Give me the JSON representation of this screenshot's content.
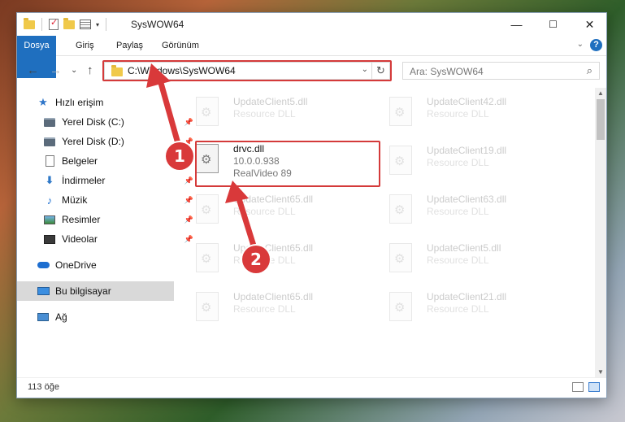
{
  "window": {
    "title": "SysWOW64",
    "minimize": "—",
    "maximize": "☐",
    "close": "✕"
  },
  "ribbon": {
    "tabs": [
      "Dosya",
      "Giriş",
      "Paylaş",
      "Görünüm"
    ],
    "expand": "⌄",
    "help": "?"
  },
  "nav": {
    "back": "←",
    "forward": "→",
    "recent": "⌄",
    "up": "↑",
    "address": "C:\\Windows\\SysWOW64",
    "address_dropdown": "⌄",
    "refresh": "↻",
    "search_placeholder": "Ara: SysWOW64",
    "search_icon": "⌕"
  },
  "sidebar": {
    "items": [
      {
        "label": "Hızlı erişim",
        "icon": "star-icon",
        "pinned": false
      },
      {
        "label": "Yerel Disk (C:)",
        "icon": "drive-icon",
        "pinned": true
      },
      {
        "label": "Yerel Disk (D:)",
        "icon": "drive-icon",
        "pinned": true
      },
      {
        "label": "Belgeler",
        "icon": "document-icon",
        "pinned": true
      },
      {
        "label": "İndirmeler",
        "icon": "download-icon",
        "pinned": true
      },
      {
        "label": "Müzik",
        "icon": "music-icon",
        "pinned": true
      },
      {
        "label": "Resimler",
        "icon": "pictures-icon",
        "pinned": true
      },
      {
        "label": "Videolar",
        "icon": "video-icon",
        "pinned": true
      },
      {
        "label": "OneDrive",
        "icon": "cloud-icon",
        "pinned": false
      },
      {
        "label": "Bu bilgisayar",
        "icon": "computer-icon",
        "pinned": false,
        "selected": true
      },
      {
        "label": "Ağ",
        "icon": "network-icon",
        "pinned": false
      }
    ]
  },
  "files": {
    "left": [
      {
        "name": "UpdateClient5.dll",
        "type": "Resource DLL"
      },
      {
        "name": "drvc.dll",
        "version": "10.0.0.938",
        "company": "RealVideo 89",
        "highlighted": true
      },
      {
        "name": "UpdateClient65.dll",
        "type": "Resource DLL"
      },
      {
        "name": "UpdateClient65.dll",
        "type": "Resource DLL"
      },
      {
        "name": "UpdateClient65.dll",
        "type": "Resource DLL"
      }
    ],
    "right": [
      {
        "name": "UpdateClient42.dll",
        "type": "Resource DLL"
      },
      {
        "name": "UpdateClient19.dll",
        "type": "Resource DLL"
      },
      {
        "name": "UpdateClient63.dll",
        "type": "Resource DLL"
      },
      {
        "name": "UpdateClient5.dll",
        "type": "Resource DLL"
      },
      {
        "name": "UpdateClient21.dll",
        "type": "Resource DLL"
      }
    ]
  },
  "status": {
    "item_count": "113 öğe"
  },
  "annotations": {
    "step1": "1",
    "step2": "2",
    "color": "#d9393a"
  }
}
